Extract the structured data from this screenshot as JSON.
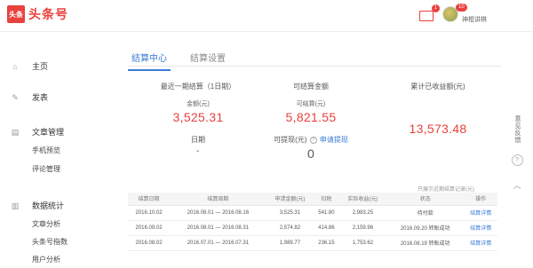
{
  "header": {
    "logo_box": "头条",
    "logo_text": "头条号",
    "mail_badge": "1",
    "user_badge": "10",
    "username": "神棍讲棋"
  },
  "sidebar": {
    "home": "主页",
    "publish": "发表",
    "article_manage": "文章管理",
    "mobile_preview": "手机预览",
    "comment_manage": "评论管理",
    "data_stats": "数据统计",
    "article_analysis": "文章分析",
    "subscribers": "头条号指数",
    "user_analysis": "用户分析"
  },
  "tabs": [
    "结算中心",
    "结算设置"
  ],
  "stats": {
    "last_cycle_title": "最近一期结算（1日期）",
    "amount_label": "金额(元)",
    "amount_value": "3,525.31",
    "date_label": "日期",
    "date_value": "-",
    "pending_title": "可结算金额",
    "pending_label": "可结算(元)",
    "pending_value": "5,821.55",
    "withdraw_label": "可提现(元)",
    "withdraw_link": "申请提现",
    "withdraw_value": "0",
    "total_title": "累计已收益额(元)",
    "total_value": "13,573.48"
  },
  "table_note": "只展示近期结算记录(元)",
  "table": {
    "headers": [
      "结算日期",
      "结算周期",
      "申请金额(元)",
      "扣税",
      "实际收益(元)",
      "状态",
      "操作"
    ],
    "rows": [
      [
        "2016.10.02",
        "2016.08.01 — 2016.08.16",
        "3,525.31",
        "541.80",
        "2,983.25",
        "待付款",
        "结算详情"
      ],
      [
        "2016.09.02",
        "2016.08.01 — 2016.08.31",
        "2,574.82",
        "414.86",
        "2,159.96",
        "2016.09.20 转账成功",
        "结算详情"
      ],
      [
        "2016.08.02",
        "2016.07.01 — 2016.07.31",
        "1,989.77",
        "236.15",
        "1,753.62",
        "2016.08.19 转账成功",
        "结算详情"
      ]
    ]
  },
  "float": {
    "feedback": "意见反馈"
  }
}
